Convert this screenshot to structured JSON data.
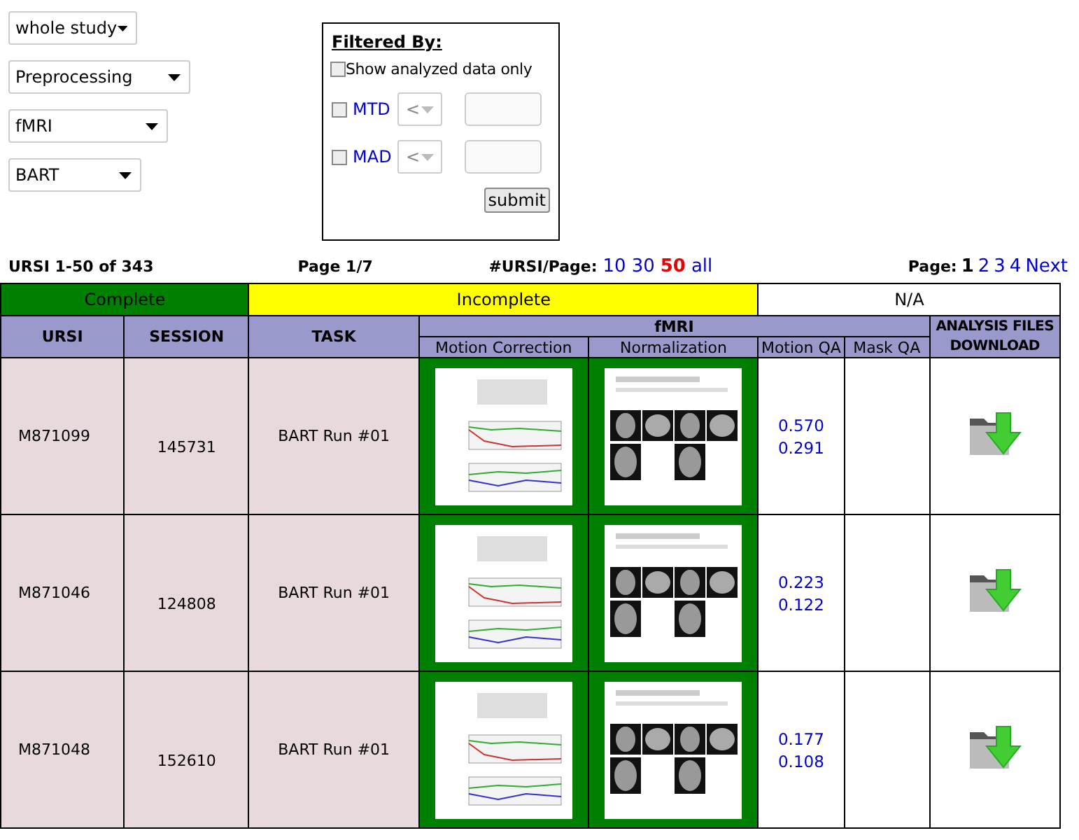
{
  "selects": [
    {
      "value": "whole study"
    },
    {
      "value": "Preprocessing"
    },
    {
      "value": "fMRI"
    },
    {
      "value": "BART"
    }
  ],
  "filter": {
    "title": "Filtered By:",
    "analyzed_only": {
      "label": "Show analyzed data only",
      "checked": false
    },
    "criteria": [
      {
        "label": "MTD",
        "checked": false,
        "operator": "<"
      },
      {
        "label": "MAD",
        "checked": false,
        "operator": "<"
      }
    ],
    "submit": "submit"
  },
  "summary": {
    "range": "URSI 1-50 of 343",
    "page": "Page 1/7",
    "per_page_label": "#URSI/Page:",
    "per_page_options": [
      {
        "label": "10",
        "selected": false
      },
      {
        "label": "30",
        "selected": false
      },
      {
        "label": "50",
        "selected": true
      },
      {
        "label": "all",
        "selected": false
      }
    ],
    "pages_label": "Page:",
    "pages": [
      {
        "label": "1",
        "selected": true
      },
      {
        "label": "2",
        "selected": false
      },
      {
        "label": "3",
        "selected": false
      },
      {
        "label": "4",
        "selected": false
      },
      {
        "label": "Next",
        "selected": false
      }
    ]
  },
  "legend": [
    {
      "label": "Complete",
      "color": "#008000"
    },
    {
      "label": "Incomplete",
      "color": "#ffff00"
    },
    {
      "label": "N/A",
      "color": "#ffffff"
    }
  ],
  "table": {
    "columns": [
      "URSI",
      "SESSION",
      "TASK"
    ],
    "group": "fMRI",
    "subcolumns": [
      "Motion Correction",
      "Normalization",
      "Motion QA",
      "Mask QA"
    ],
    "last_column": "ANALYSIS FILES DOWNLOAD",
    "rows": [
      {
        "ursi": "M871099",
        "session": "145731",
        "task": "BART Run #01",
        "motion_correction": {
          "color": "#008000"
        },
        "normalization": {
          "color": "#008000"
        },
        "motion_qa": [
          "0.570",
          "0.291"
        ]
      },
      {
        "ursi": "M871046",
        "session": "124808",
        "task": "BART Run #01",
        "motion_correction": {
          "color": "#008000"
        },
        "normalization": {
          "color": "#008000"
        },
        "motion_qa": [
          "0.223",
          "0.122"
        ]
      },
      {
        "ursi": "M871048",
        "session": "152610",
        "task": "BART Run #01",
        "motion_correction": {
          "color": "#008000"
        },
        "normalization": {
          "color": "#008000"
        },
        "motion_qa": [
          "0.177",
          "0.108"
        ]
      }
    ]
  }
}
